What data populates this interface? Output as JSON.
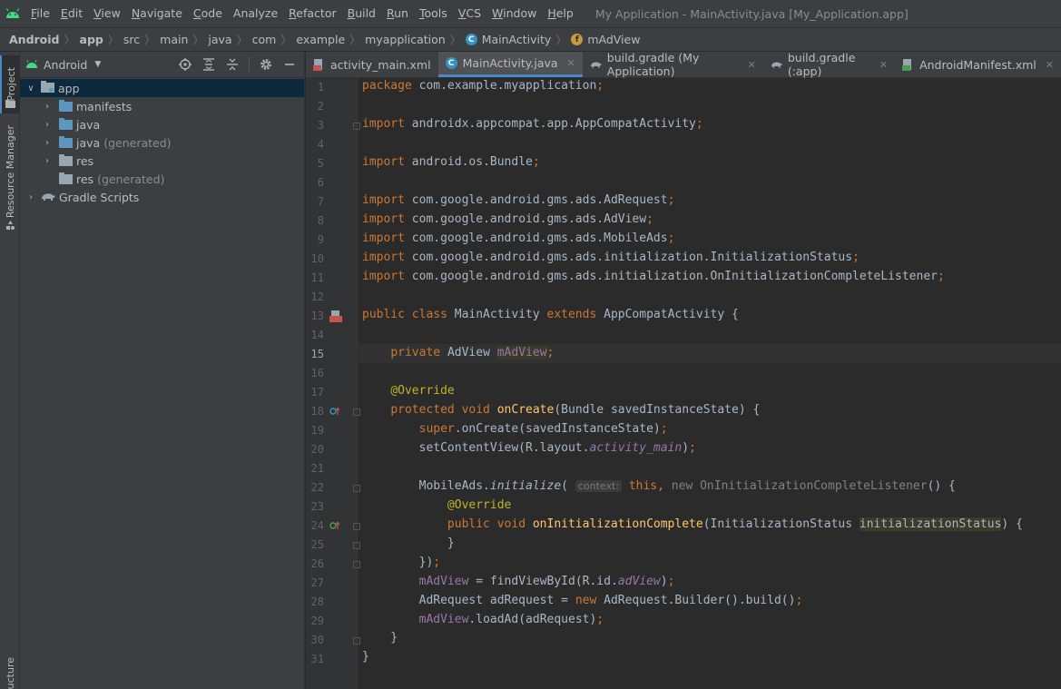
{
  "menubar": {
    "items": [
      {
        "label": "File",
        "u": "F",
        "rest": "ile"
      },
      {
        "label": "Edit",
        "u": "E",
        "rest": "dit"
      },
      {
        "label": "View",
        "u": "V",
        "rest": "iew"
      },
      {
        "label": "Navigate",
        "u": "N",
        "rest": "avigate"
      },
      {
        "label": "Code",
        "u": "C",
        "rest": "ode"
      },
      {
        "label": "Analyze",
        "u": "",
        "rest": "Analyze"
      },
      {
        "label": "Refactor",
        "u": "R",
        "rest": "efactor"
      },
      {
        "label": "Build",
        "u": "B",
        "rest": "uild"
      },
      {
        "label": "Run",
        "u": "R",
        "rest": "un"
      },
      {
        "label": "Tools",
        "u": "T",
        "rest": "ools"
      },
      {
        "label": "VCS",
        "u": "V",
        "rest": "CS"
      },
      {
        "label": "Window",
        "u": "W",
        "rest": "indow"
      },
      {
        "label": "Help",
        "u": "H",
        "rest": "elp"
      }
    ],
    "window_title": "My Application - MainActivity.java [My_Application.app]"
  },
  "breadcrumb": [
    "Android",
    "app",
    "src",
    "main",
    "java",
    "com",
    "example",
    "myapplication",
    "MainActivity",
    "mAdView"
  ],
  "toolstripe": {
    "project": "Project",
    "resource_manager": "Resource Manager",
    "structure": "ucture"
  },
  "project_panel": {
    "view": "Android",
    "tree": [
      {
        "label": "app",
        "dim": "",
        "expanded": true
      },
      {
        "label": "manifests",
        "dim": ""
      },
      {
        "label": "java",
        "dim": ""
      },
      {
        "label": "java",
        "dim": "(generated)"
      },
      {
        "label": "res",
        "dim": ""
      },
      {
        "label": "res",
        "dim": "(generated)"
      },
      {
        "label": "Gradle Scripts",
        "dim": ""
      }
    ]
  },
  "tabs": [
    {
      "label": "activity_main.xml",
      "icon": "xml-layout-icon"
    },
    {
      "label": "MainActivity.java",
      "icon": "java-class-icon",
      "active": true
    },
    {
      "label": "build.gradle (My Application)",
      "icon": "gradle-icon"
    },
    {
      "label": "build.gradle (:app)",
      "icon": "gradle-icon"
    },
    {
      "label": "AndroidManifest.xml",
      "icon": "manifest-icon"
    }
  ],
  "editor": {
    "current_line": 15,
    "line_count": 31,
    "hint_context": "context:"
  },
  "colors": {
    "accent": "#4a88c7",
    "keyword": "#cc7832",
    "function": "#ffc66d",
    "field": "#9876aa",
    "annotation": "#bbb529"
  }
}
